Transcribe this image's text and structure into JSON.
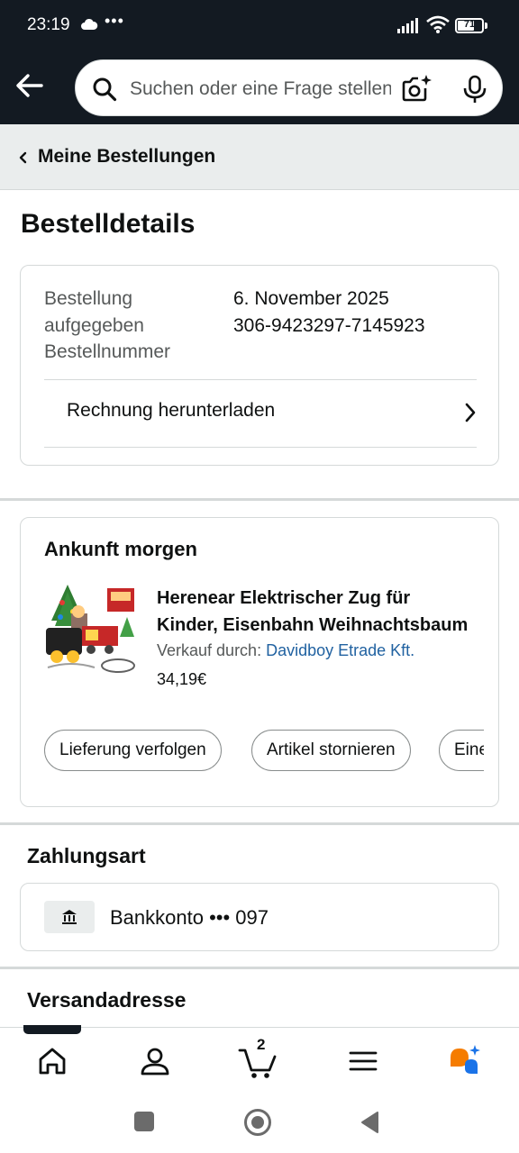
{
  "status_bar": {
    "time": "23:19",
    "overflow": "•••",
    "battery": "71",
    "battery_level": 0.71
  },
  "header": {
    "back_icon": "arrow-left-icon",
    "search": {
      "placeholder": "Suchen oder eine Frage stellen"
    },
    "camera_icon": "camera-sparkle-icon",
    "mic_icon": "microphone-icon"
  },
  "breadcrumb": {
    "label": "Meine Bestellungen"
  },
  "page": {
    "title": "Bestelldetails"
  },
  "order_summary": {
    "labels": [
      "Bestellung",
      "aufgegeben",
      "Bestellnummer"
    ],
    "values": [
      "6. November 2025",
      "306-9423297-7145923"
    ],
    "invoice_label": "Rechnung herunterladen"
  },
  "shipment": {
    "heading": "Ankunft morgen",
    "product": {
      "title_line1": "Herenear Elektrischer Zug für",
      "title_line2": "Kinder, Eisenbahn Weihnachtsbaum",
      "seller_prefix": "Verkauf durch:",
      "seller_name": "Davidboy Etrade Kft.",
      "price": "34,19€"
    },
    "actions": [
      "Lieferung verfolgen",
      "Artikel stornieren",
      "Einen Artikel zurücksenden"
    ]
  },
  "payment": {
    "section_title": "Zahlungsart",
    "method": "Bankkonto ••• 097",
    "icon": "bank-icon"
  },
  "shipping_address": {
    "section_title": "Versandadresse"
  },
  "bottom_nav": {
    "items": [
      "home-icon",
      "account-icon",
      "cart-icon",
      "menu-icon",
      "rufus-icon"
    ],
    "cart_count": "2"
  },
  "colors": {
    "header_bg": "#131a22",
    "link": "#2162a1",
    "rufus_orange": "#f57c00",
    "rufus_blue": "#1a73e8"
  }
}
